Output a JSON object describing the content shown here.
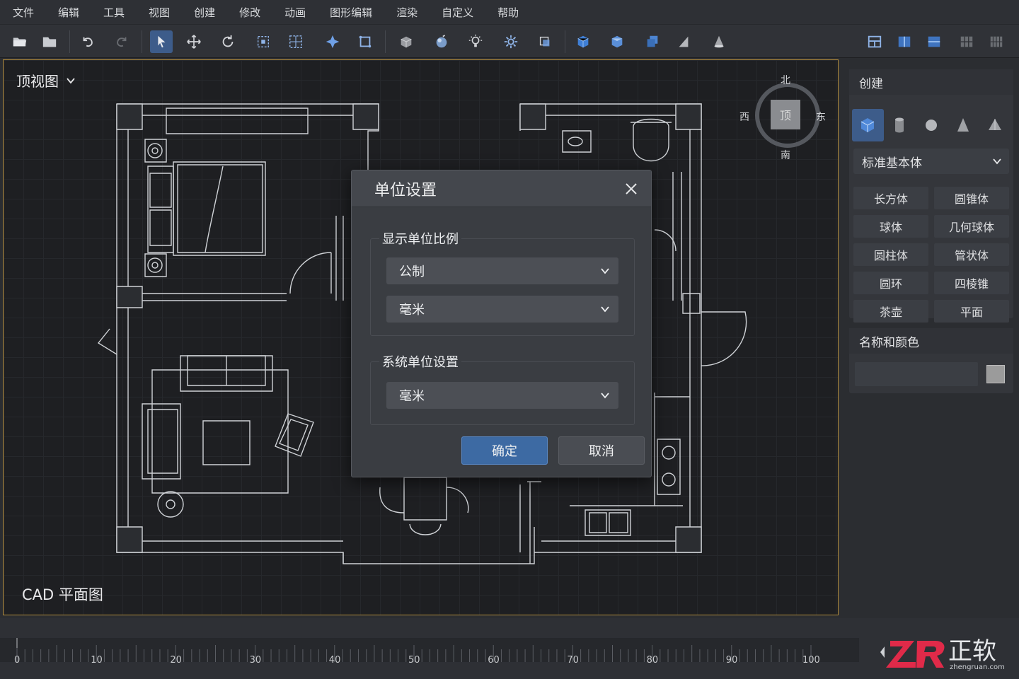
{
  "menu": [
    "文件",
    "编辑",
    "工具",
    "视图",
    "创建",
    "修改",
    "动画",
    "图形编辑",
    "渲染",
    "自定义",
    "帮助"
  ],
  "viewport": {
    "view_name": "顶视图",
    "plan_label": "CAD 平面图",
    "viewcube": {
      "face": "顶",
      "north": "北",
      "south": "南",
      "east": "东",
      "west": "西"
    }
  },
  "right_panel": {
    "create_title": "创建",
    "type_select": "标准基本体",
    "objects": [
      "长方体",
      "圆锥体",
      "球体",
      "几何球体",
      "圆柱体",
      "管状体",
      "圆环",
      "四棱锥",
      "茶壶",
      "平面"
    ],
    "name_color_title": "名称和颜色",
    "name_value": "",
    "swatch_color": "#9b9b9b"
  },
  "dialog": {
    "title": "单位设置",
    "display_group": "显示单位比例",
    "display_scale": "公制",
    "display_unit": "毫米",
    "system_group": "系统单位设置",
    "system_unit": "毫米",
    "ok": "确定",
    "cancel": "取消"
  },
  "timeline": {
    "ticks": [
      "0",
      "10",
      "20",
      "30",
      "40",
      "50",
      "60",
      "70",
      "80",
      "90",
      "100"
    ]
  },
  "watermark": {
    "brand_letters": "ZR",
    "brand_name": "正软",
    "domain": "zhengruan.com"
  },
  "colors": {
    "accent": "#3d6aa3",
    "viewport_border": "#b08a3c",
    "logo_red": "#e02a49"
  }
}
